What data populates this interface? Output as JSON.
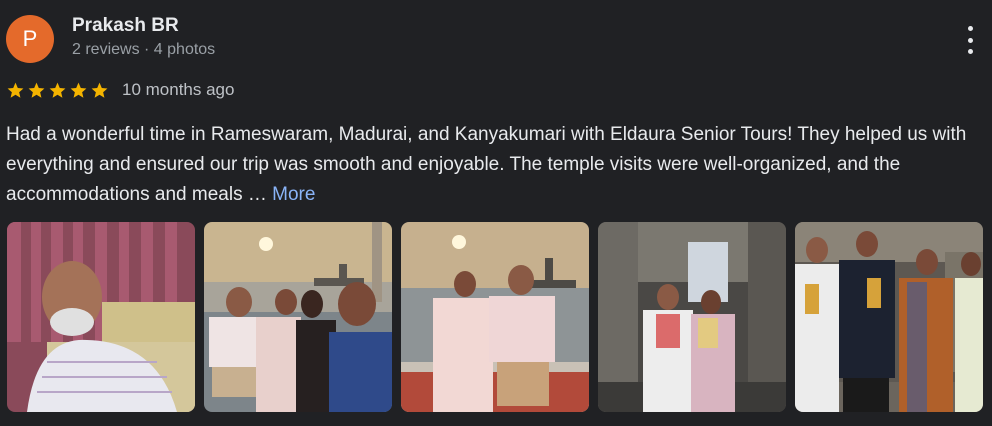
{
  "reviewer": {
    "initial": "P",
    "name": "Prakash BR",
    "meta": "2 reviews · 4 photos",
    "avatar_color": "#e46a2b"
  },
  "rating": {
    "stars": 5,
    "max": 5,
    "color": "#f4b400",
    "time": "10 months ago"
  },
  "review": {
    "text": "Had a wonderful time in Rameswaram, Madurai, and Kanyakumari with Eldaura Senior Tours! They helped us with everything and ensured our trip was smooth and enjoyable. The temple visits were well-organized, and the accommodations and meals … ",
    "more_label": "More"
  },
  "menu": {
    "icon": "more-vert-icon"
  },
  "photos": [
    {
      "id": "photo-1"
    },
    {
      "id": "photo-2"
    },
    {
      "id": "photo-3"
    },
    {
      "id": "photo-4"
    },
    {
      "id": "photo-5"
    }
  ]
}
